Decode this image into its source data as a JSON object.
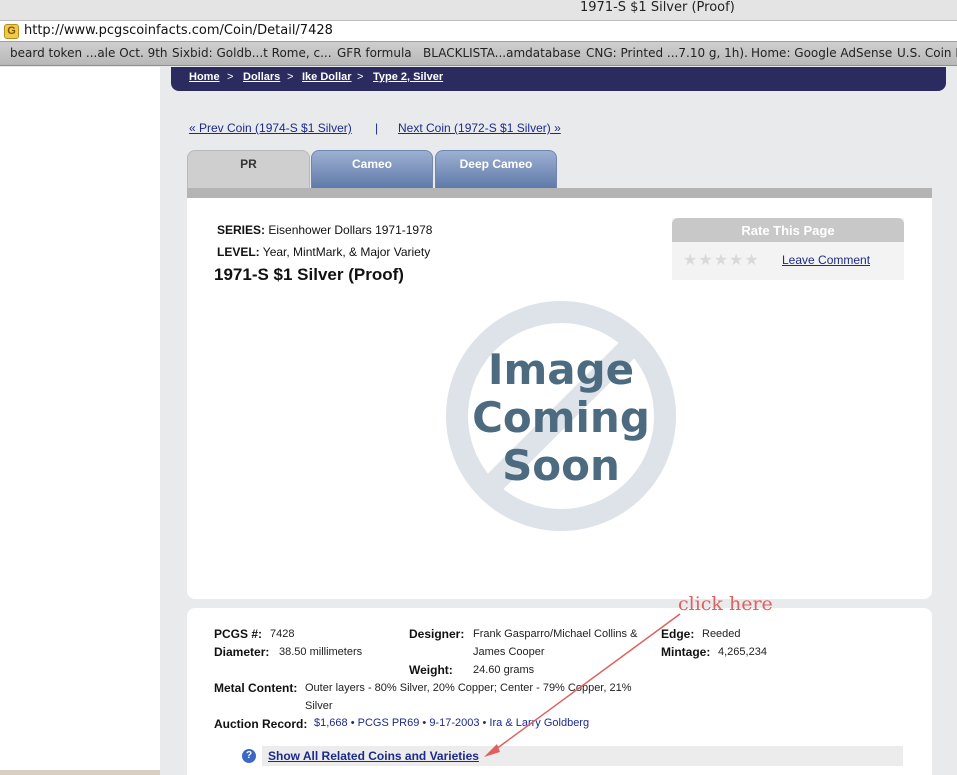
{
  "window": {
    "title": "1971-S $1 Silver (Proof)"
  },
  "address_bar": {
    "url": "http://www.pcgscoinfacts.com/Coin/Detail/7428",
    "favicon": "coin-favicon-icon"
  },
  "bookmarks": [
    "beard token ...ale Oct. 9th",
    "Sixbid: Goldb...t Rome, c...",
    "GFR formula",
    "BLACKLISTA...amdatabase",
    "CNG: Printed ...7.10 g, 1h).",
    "Home: Google AdSense",
    "U.S. Coin M"
  ],
  "breadcrumb": {
    "items": [
      "Home",
      "Dollars",
      "Ike Dollar",
      "Type 2, Silver"
    ],
    "separator": ">"
  },
  "coin_nav": {
    "prev": "« Prev Coin (1974-S $1 Silver)",
    "separator": "|",
    "next": "Next Coin (1972-S $1 Silver) »"
  },
  "tabs": [
    {
      "label": "PR",
      "active": true
    },
    {
      "label": "Cameo",
      "active": false
    },
    {
      "label": "Deep Cameo",
      "active": false
    }
  ],
  "coin": {
    "series_label": "SERIES:",
    "series_value": "Eisenhower Dollars 1971-1978",
    "level_label": "LEVEL:",
    "level_value": "Year, MintMark, & Major Variety",
    "title": "1971-S $1 Silver (Proof)"
  },
  "rating": {
    "header": "Rate This Page",
    "stars_max": 5,
    "stars_value": 0,
    "leave_comment": "Leave Comment"
  },
  "image_placeholder": {
    "line1": "Image",
    "line2": "Coming",
    "line3": "Soon"
  },
  "details": {
    "pcgs_label": "PCGS #:",
    "pcgs_value": "7428",
    "diameter_label": "Diameter:",
    "diameter_value": "38.50 millimeters",
    "designer_label": "Designer:",
    "designer_value_1": "Frank Gasparro/Michael Collins &",
    "designer_value_2": "James Cooper",
    "weight_label": "Weight:",
    "weight_value": "24.60 grams",
    "edge_label": "Edge:",
    "edge_value": "Reeded",
    "mintage_label": "Mintage:",
    "mintage_value": "4,265,234",
    "metal_label": "Metal Content:",
    "metal_value_1": "Outer layers - 80% Silver, 20% Copper; Center - 79% Copper, 21%",
    "metal_value_2": "Silver",
    "auction_label": "Auction Record:",
    "auction_value": "$1,668 • PCGS PR69 • 9-17-2003 • Ira & Larry Goldberg"
  },
  "related": {
    "label": "Show All Related Coins and Varieties",
    "help": "?"
  },
  "annotation": {
    "text": "click here",
    "color": "#e06060"
  },
  "colors": {
    "nav_bar": "#2b2b5f",
    "link": "#1c2a8c",
    "tab_blue": "#5f7aa9"
  }
}
